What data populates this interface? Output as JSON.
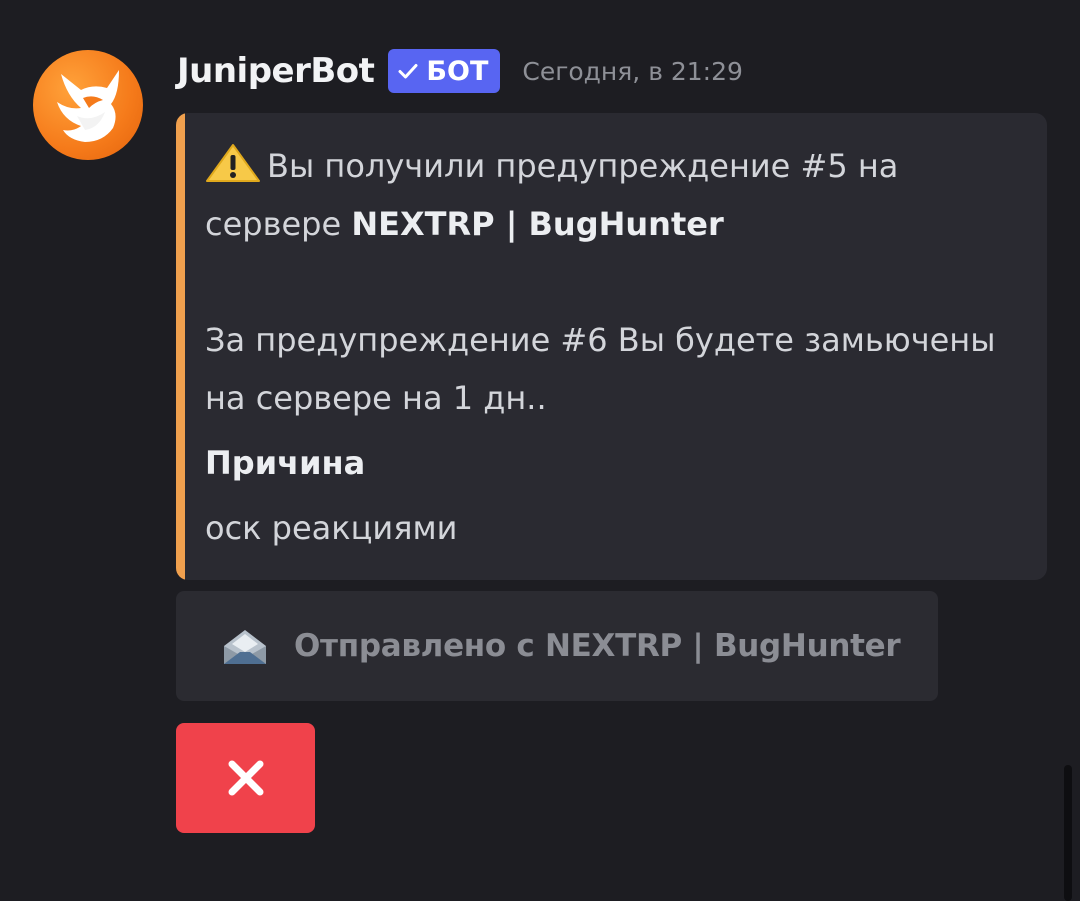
{
  "message": {
    "author": "JuniperBot",
    "bot_tag": "БОТ",
    "timestamp": "Сегодня, в 21:29",
    "avatar_icon": "fox-logo-icon"
  },
  "embed": {
    "accent_color": "#f0a04e",
    "warning_icon": "warning-icon",
    "line1_prefix": "Вы получили предупреждение #5 на сервере ",
    "server_name": "NEXTRP | BugHunter",
    "line2": "За предупреждение #6 Вы будете замьючены на сервере на 1 дн..",
    "field_name": "Причина",
    "field_value": "оск реакциями"
  },
  "footer_button": {
    "icon": "incoming-envelope-icon",
    "label": "Отправлено с NEXTRP | BugHunter"
  },
  "close_button": {
    "icon": "close-icon",
    "color": "#f0424b"
  }
}
